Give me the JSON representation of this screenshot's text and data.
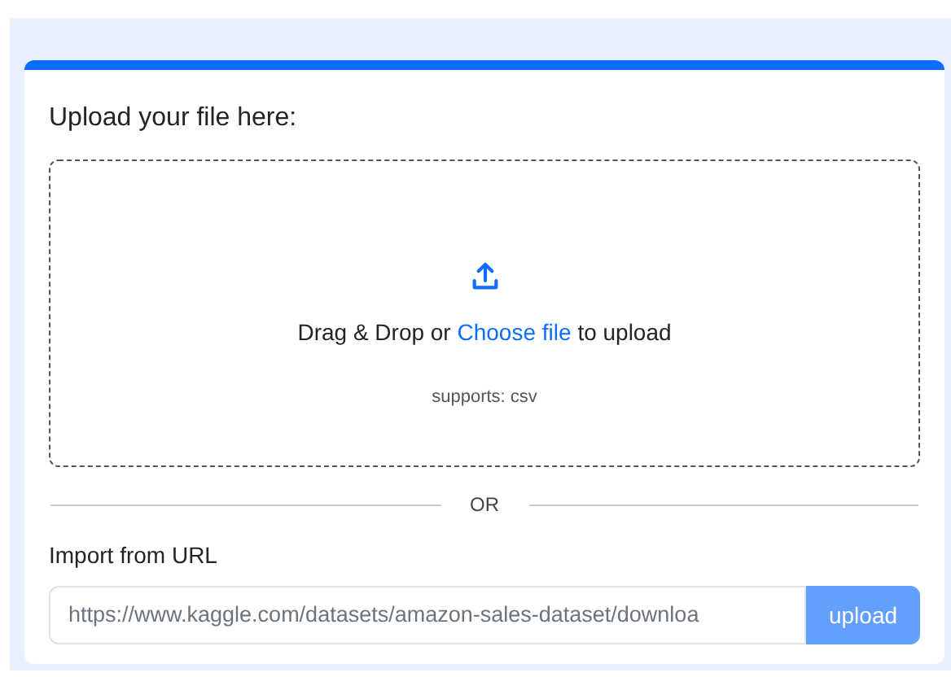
{
  "heading": "Upload your file here:",
  "dropzone": {
    "text_before": "Drag & Drop or",
    "link": "Choose file",
    "text_after": "to upload",
    "supports": "supports: csv"
  },
  "divider": "OR",
  "url_import": {
    "label": "Import from URL",
    "placeholder": "https://www.kaggle.com/datasets/amazon-sales-dataset/downloa",
    "button": "upload"
  }
}
